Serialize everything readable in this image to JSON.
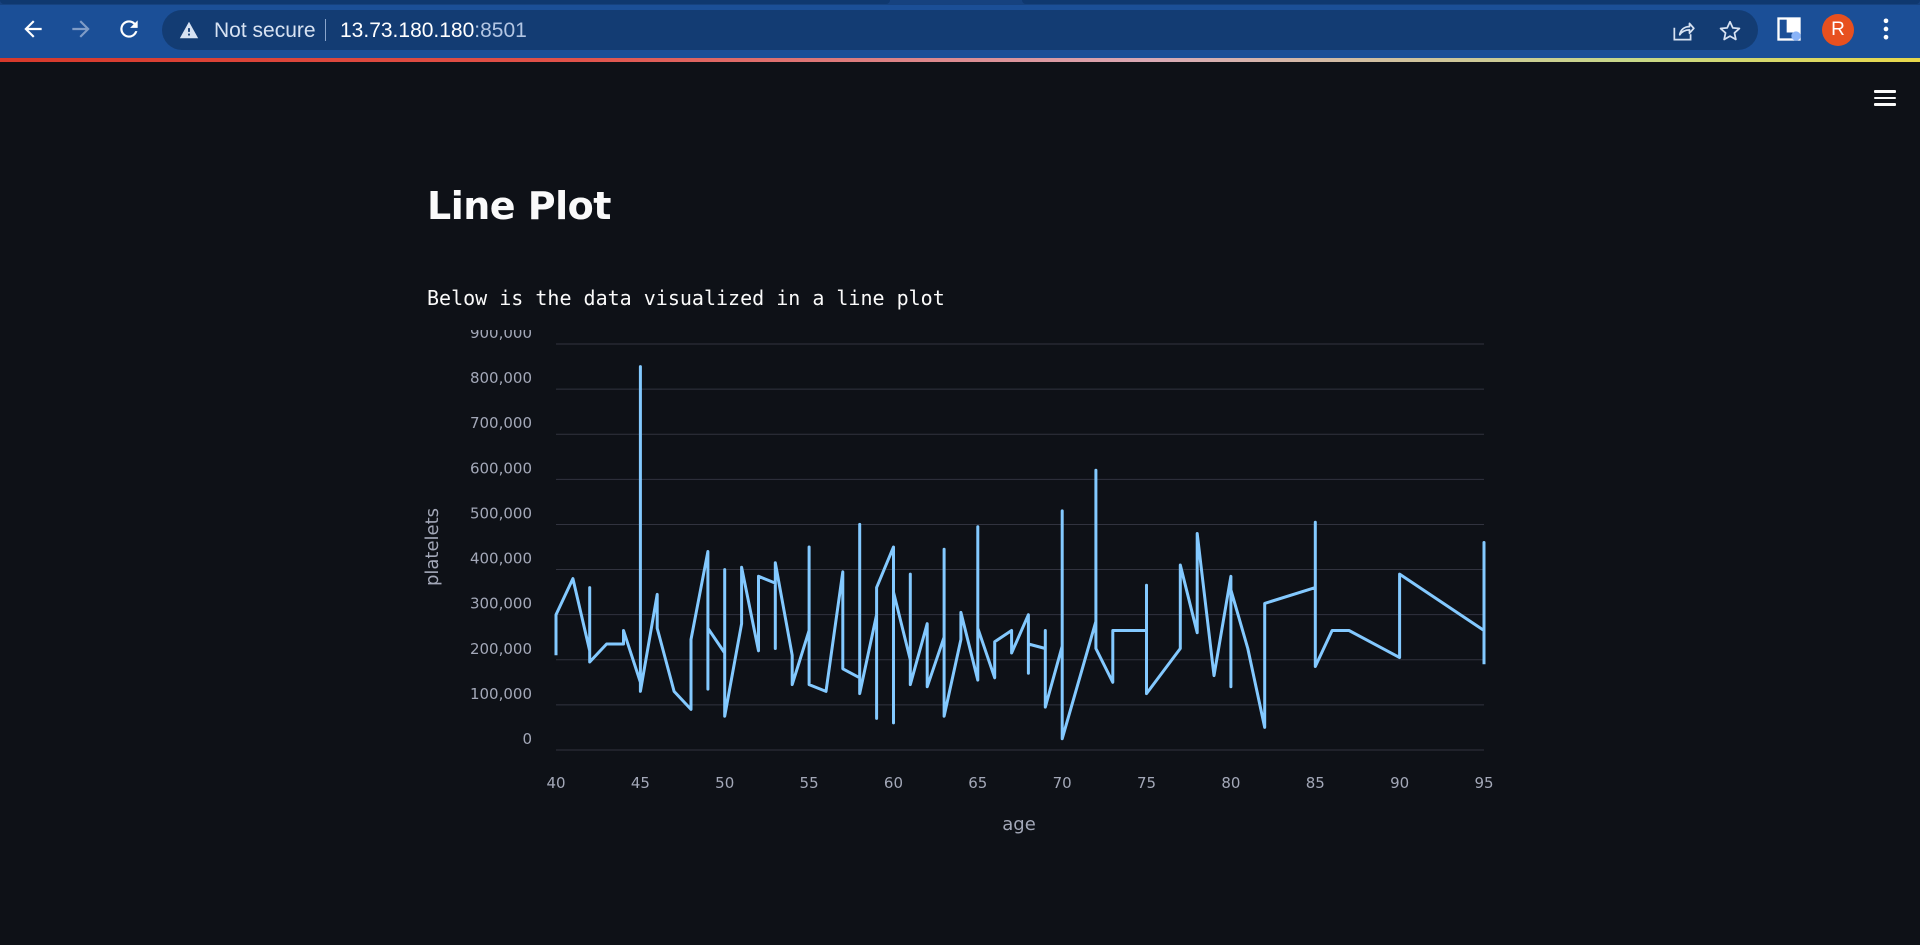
{
  "browser": {
    "security_label": "Not secure",
    "url_host": "13.73.180.180",
    "url_port": ":8501",
    "profile_initial": "R",
    "icons": [
      "back-icon",
      "forward-icon",
      "reload-icon",
      "warning-icon",
      "share-icon",
      "star-icon",
      "extension-icon",
      "more-icon"
    ]
  },
  "app": {
    "menu_icon": "hamburger-icon",
    "title": "Line Plot",
    "description": "Below is the data visualized in a line plot"
  },
  "chart_data": {
    "type": "line",
    "xlabel": "age",
    "ylabel": "platelets",
    "xlim": [
      40,
      95
    ],
    "ylim": [
      0,
      900000
    ],
    "x_ticks": [
      "40",
      "45",
      "50",
      "55",
      "60",
      "65",
      "70",
      "75",
      "80",
      "85",
      "90",
      "95"
    ],
    "y_ticks": [
      "0",
      "100,000",
      "200,000",
      "300,000",
      "400,000",
      "500,000",
      "600,000",
      "700,000",
      "800,000",
      "900,000"
    ],
    "grid": true,
    "line_color": "#83c9ff",
    "x": [
      40,
      40,
      41,
      42,
      42,
      42,
      43,
      44,
      44,
      45,
      45,
      45,
      46,
      46,
      47,
      48,
      48,
      49,
      49,
      49,
      50,
      50,
      50,
      51,
      51,
      52,
      52,
      53,
      53,
      53,
      54,
      54,
      55,
      55,
      55,
      56,
      57,
      57,
      58,
      58,
      58,
      59,
      59,
      59,
      60,
      60,
      60,
      61,
      61,
      61,
      62,
      62,
      63,
      63,
      63,
      64,
      64,
      65,
      65,
      65,
      66,
      66,
      67,
      67,
      68,
      68,
      68,
      69,
      69,
      69,
      70,
      70,
      70,
      72,
      72,
      72,
      73,
      73,
      75,
      75,
      75,
      77,
      77,
      78,
      78,
      79,
      80,
      80,
      80,
      81,
      82,
      82,
      85,
      85,
      85,
      86,
      87,
      90,
      90,
      95,
      95,
      95
    ],
    "y": [
      210000,
      300000,
      380000,
      220000,
      360000,
      195000,
      235000,
      235000,
      265000,
      150000,
      850000,
      130000,
      345000,
      270000,
      130000,
      90000,
      245000,
      440000,
      135000,
      270000,
      215000,
      400000,
      75000,
      280000,
      405000,
      220000,
      385000,
      370000,
      225000,
      415000,
      210000,
      145000,
      265000,
      450000,
      145000,
      130000,
      395000,
      180000,
      160000,
      500000,
      125000,
      300000,
      70000,
      360000,
      450000,
      60000,
      350000,
      200000,
      390000,
      145000,
      280000,
      140000,
      250000,
      445000,
      75000,
      245000,
      305000,
      155000,
      495000,
      270000,
      160000,
      240000,
      265000,
      215000,
      300000,
      170000,
      235000,
      225000,
      265000,
      95000,
      230000,
      530000,
      25000,
      285000,
      620000,
      225000,
      150000,
      265000,
      265000,
      365000,
      125000,
      225000,
      410000,
      260000,
      480000,
      165000,
      385000,
      140000,
      355000,
      225000,
      50000,
      325000,
      360000,
      505000,
      185000,
      265000,
      265000,
      205000,
      390000,
      265000,
      460000,
      190000
    ]
  }
}
